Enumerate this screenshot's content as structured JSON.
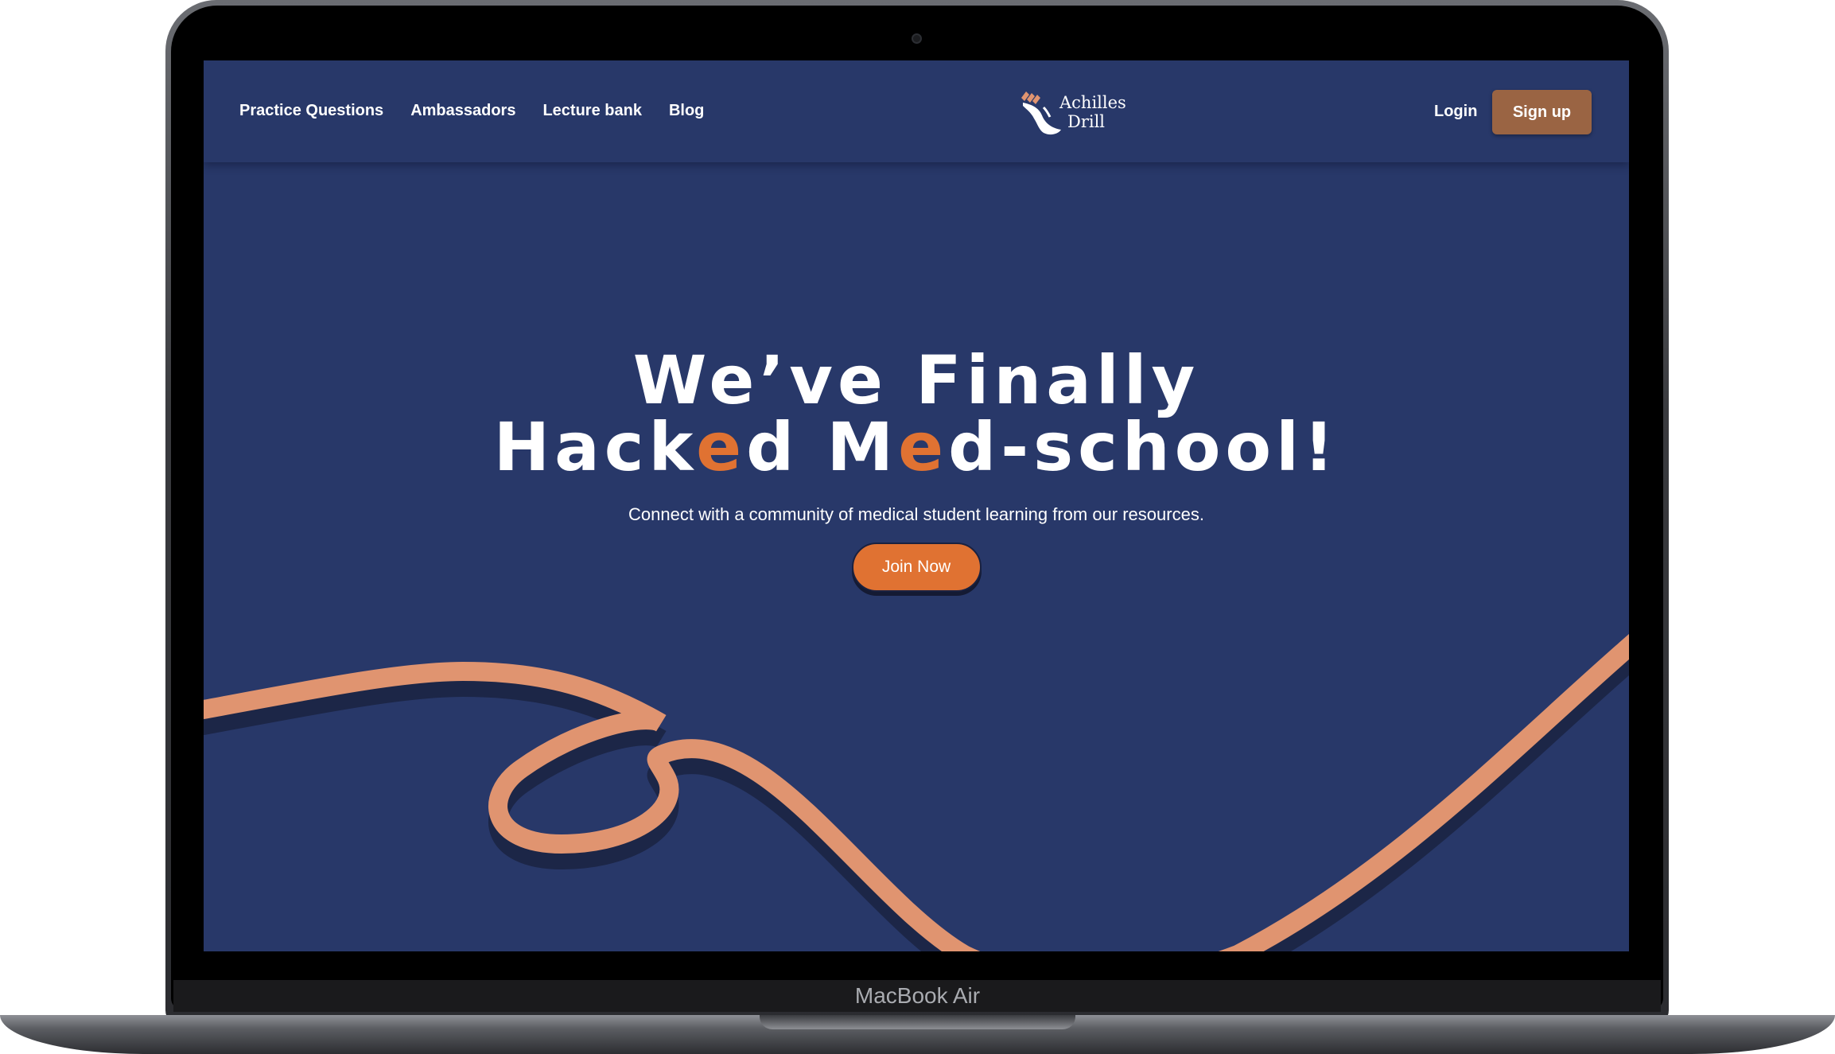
{
  "device": {
    "model_label": "MacBook Air"
  },
  "nav": {
    "links": [
      "Practice Questions",
      "Ambassadors",
      "Lecture bank",
      "Blog"
    ],
    "login_label": "Login",
    "signup_label": "Sign up"
  },
  "logo": {
    "line1": "Achilles",
    "line2": "Drill",
    "icon": "running-foot-icon"
  },
  "hero": {
    "title_line1": "We’ve Finally",
    "title_line2_parts": [
      "Hack",
      "e",
      "d M",
      "e",
      "d-school!"
    ],
    "subtitle": "Connect with a community of medical student learning from our resources.",
    "cta_label": "Join Now"
  },
  "colors": {
    "page_background": "#283869",
    "accent_orange": "#e07232",
    "rope_salmon": "#e09470",
    "signup_brown": "#9a6443",
    "text": "#ffffff"
  }
}
